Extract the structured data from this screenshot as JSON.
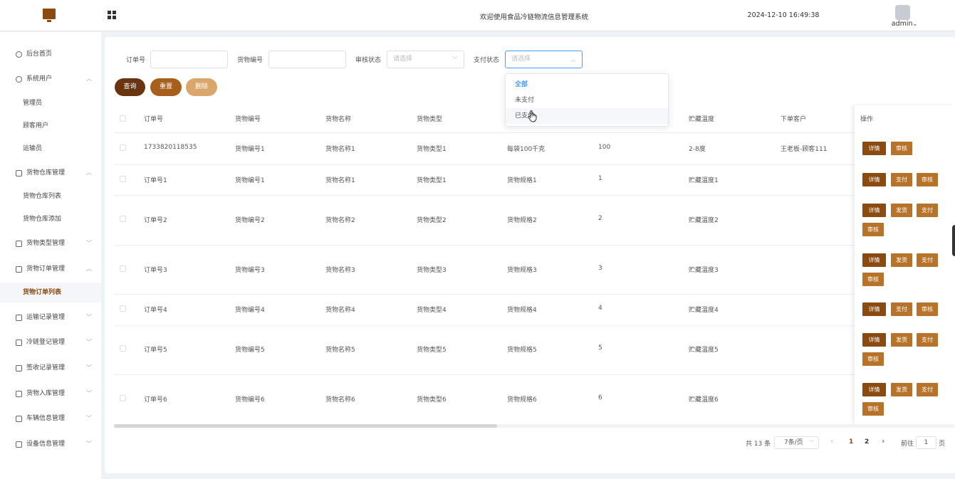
{
  "header": {
    "title": "欢迎使用食品冷链物流信息管理系统",
    "datetime": "2024-12-10 16:49:38",
    "user": "admin",
    "user_chevron": "⌄"
  },
  "sidebar": {
    "home": "后台首页",
    "sys_users": "系统用户",
    "admin": "管理员",
    "customer": "顾客用户",
    "transporter": "运输员",
    "warehouse_mgmt": "货物仓库管理",
    "warehouse_list": "货物仓库列表",
    "warehouse_add": "货物仓库添加",
    "type_mgmt": "货物类型管理",
    "order_mgmt": "货物订单管理",
    "order_list": "货物订单列表",
    "transport_mgmt": "运输记录管理",
    "coldchain_mgmt": "冷链登记管理",
    "signoff_mgmt": "签收记录管理",
    "inbound_mgmt": "货物入库管理",
    "vehicle_mgmt": "车辆信息管理",
    "device_mgmt": "设备信息管理"
  },
  "filters": {
    "order_no_label": "订单号",
    "goods_no_label": "货物编号",
    "audit_label": "审核状态",
    "audit_placeholder": "请选择",
    "pay_label": "支付状态",
    "pay_placeholder": "请选择"
  },
  "buttons": {
    "query": "查询",
    "reset": "重置",
    "delete": "删除"
  },
  "dropdown": {
    "options": [
      "全部",
      "未支付",
      "已支付"
    ]
  },
  "table": {
    "headers": [
      "订单号",
      "货物编号",
      "货物名称",
      "货物类型",
      "",
      "",
      "贮藏温度",
      "下单客户",
      "操作"
    ],
    "rows": [
      {
        "c": [
          "1733820118535",
          "货物编号1",
          "货物名称1",
          "货物类型1",
          "每袋100千克",
          "100",
          "2-8度",
          "王老板-顾客111"
        ],
        "ops": [
          "详情",
          "审核"
        ]
      },
      {
        "c": [
          "订单号1",
          "货物编号1",
          "货物名称1",
          "货物类型1",
          "货物规格1",
          "1",
          "贮藏温度1",
          ""
        ],
        "ops": [
          "详情",
          "支付",
          "审核"
        ]
      },
      {
        "c": [
          "订单号2",
          "货物编号2",
          "货物名称2",
          "货物类型2",
          "货物规格2",
          "2",
          "贮藏温度2",
          ""
        ],
        "ops": [
          "详情",
          "发货",
          "支付",
          "审核"
        ]
      },
      {
        "c": [
          "订单号3",
          "货物编号3",
          "货物名称3",
          "货物类型3",
          "货物规格3",
          "3",
          "贮藏温度3",
          ""
        ],
        "ops": [
          "详情",
          "发货",
          "支付",
          "审核"
        ]
      },
      {
        "c": [
          "订单号4",
          "货物编号4",
          "货物名称4",
          "货物类型4",
          "货物规格4",
          "4",
          "贮藏温度4",
          ""
        ],
        "ops": [
          "详情",
          "支付",
          "审核"
        ]
      },
      {
        "c": [
          "订单号5",
          "货物编号5",
          "货物名称5",
          "货物类型5",
          "货物规格5",
          "5",
          "贮藏温度5",
          ""
        ],
        "ops": [
          "详情",
          "发货",
          "支付",
          "审核"
        ]
      },
      {
        "c": [
          "订单号6",
          "货物编号6",
          "货物名称6",
          "货物类型6",
          "货物规格6",
          "6",
          "贮藏温度6",
          ""
        ],
        "ops": [
          "详情",
          "发货",
          "支付",
          "审核"
        ]
      }
    ]
  },
  "pagination": {
    "total": "共 13 条",
    "page_size": "7条/页",
    "prev": "‹",
    "page1": "1",
    "page2": "2",
    "next": "›",
    "goto_label": "前往",
    "goto_value": "1",
    "goto_suffix": "页"
  },
  "colors": {
    "brand": "#8b4a0f",
    "secondary": "#b8732a",
    "query_btn": "#6b3410",
    "reset_btn": "#a85f1c",
    "delete_btn": "#d9a66c",
    "selected_option": "#409eff"
  },
  "icons": [
    "monitor-icon",
    "grid-icon",
    "clock-icon",
    "user-icon",
    "folder-icon",
    "chevron-icon",
    "hand-cursor-icon"
  ]
}
